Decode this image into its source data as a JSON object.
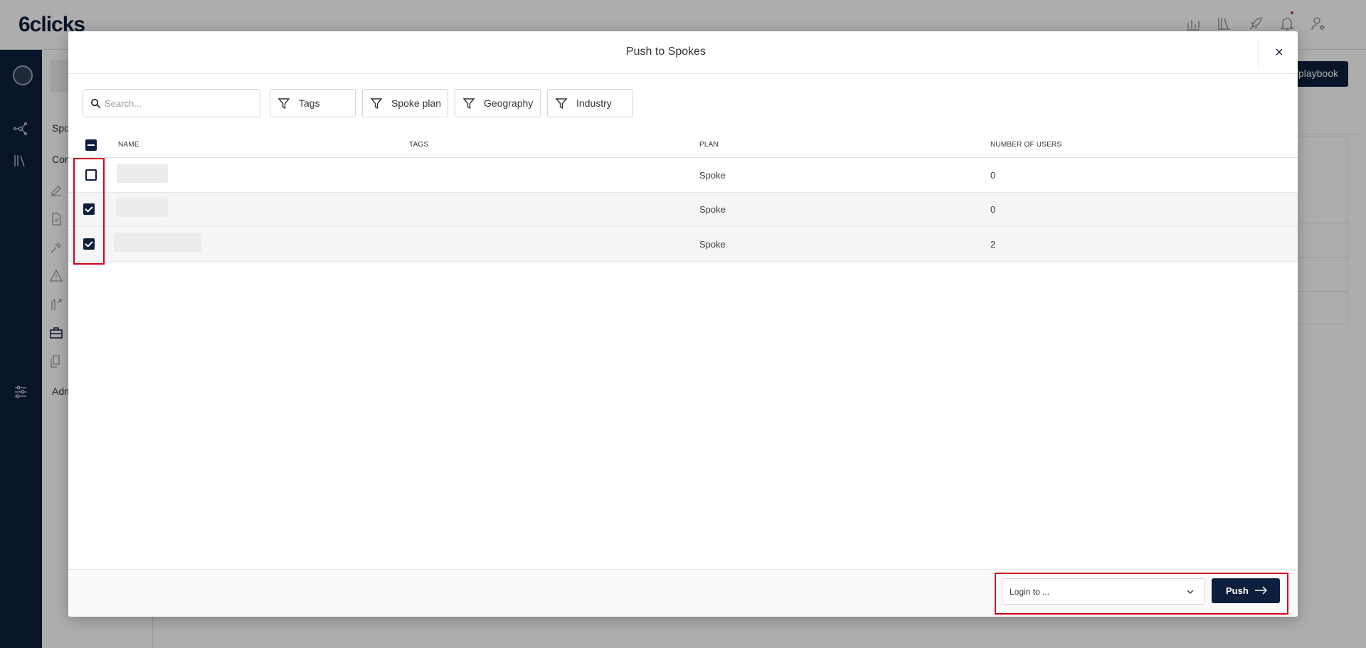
{
  "app": {
    "logo": "6clicks",
    "bg_button_label": "/playbook",
    "bg_nav_labels": [
      "Spo",
      "Con",
      "Adm"
    ]
  },
  "modal": {
    "title": "Push to Spokes",
    "close_label": "×",
    "search": {
      "placeholder": "Search...",
      "value": ""
    },
    "filters": [
      {
        "label": "Tags"
      },
      {
        "label": "Spoke plan"
      },
      {
        "label": "Geography"
      },
      {
        "label": "Industry"
      }
    ],
    "table": {
      "columns": {
        "name": "NAME",
        "tags": "TAGS",
        "plan": "PLAN",
        "users": "NUMBER OF USERS"
      },
      "header_checkbox_state": "indeterminate",
      "rows": [
        {
          "name": "",
          "tags": "",
          "plan": "Spoke",
          "users": "0",
          "checked": false
        },
        {
          "name": "",
          "tags": "",
          "plan": "Spoke",
          "users": "0",
          "checked": true
        },
        {
          "name": "",
          "tags": "",
          "plan": "Spoke",
          "users": "2",
          "checked": true
        }
      ]
    },
    "footer": {
      "login_select": {
        "selected": "Login to ..."
      },
      "push_label": "Push"
    }
  },
  "colors": {
    "brand_navy": "#0d1f3c",
    "highlight_red": "#d0021b",
    "notification_dot": "#d32f2f"
  }
}
